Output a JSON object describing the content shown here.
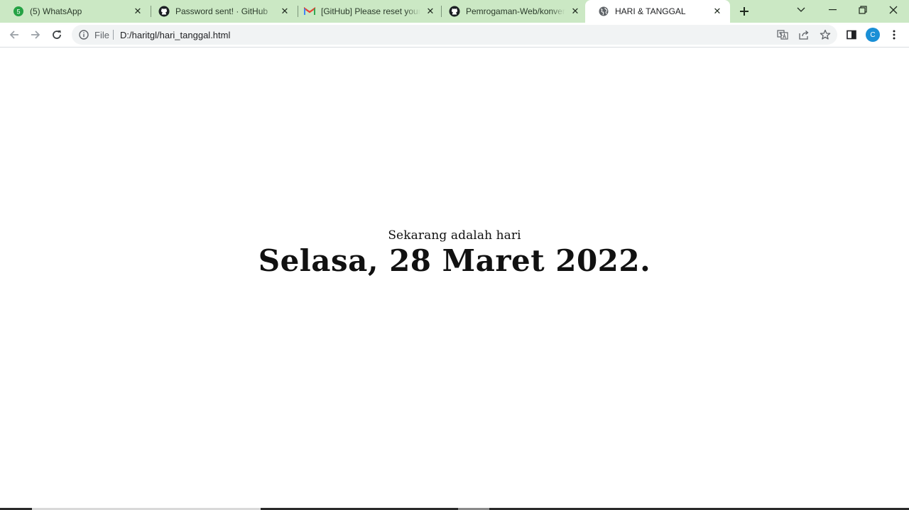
{
  "browser": {
    "tabs": [
      {
        "title": "(5) WhatsApp",
        "favicon": "whatsapp-icon",
        "active": false
      },
      {
        "title": "Password sent! · GitHub",
        "favicon": "github-icon",
        "active": false
      },
      {
        "title": "[GitHub] Please reset your password",
        "favicon": "gmail-icon",
        "active": false
      },
      {
        "title": "Pemrogaman-Web/konversi",
        "favicon": "github-icon",
        "active": false
      },
      {
        "title": "HARI & TANGGAL",
        "favicon": "globe-icon",
        "active": true
      }
    ],
    "tab_badge_count": "5",
    "omnibox": {
      "scheme": "File",
      "url": "D:/haritgl/hari_tanggal.html"
    },
    "profile_initial": "C",
    "accent_color": "#1a8fd6",
    "tabstrip_color": "#cbe8c4"
  },
  "page": {
    "intro": "Sekarang adalah hari",
    "date": "Selasa, 28 Maret 2022."
  }
}
